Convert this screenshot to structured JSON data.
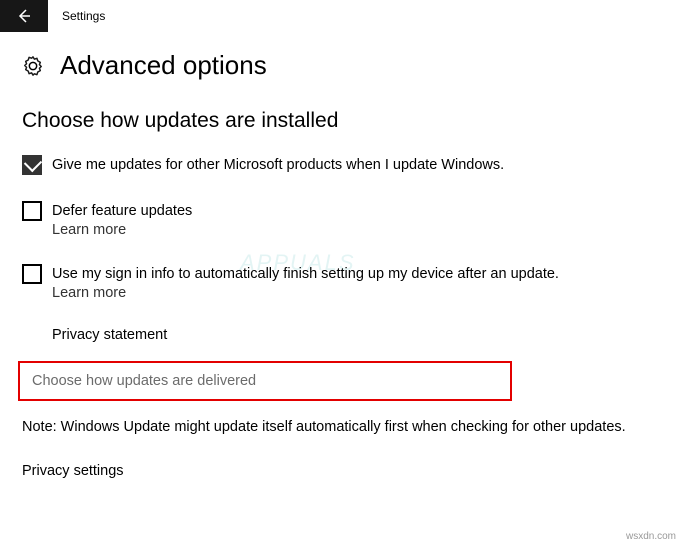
{
  "titlebar": {
    "title": "Settings"
  },
  "header": {
    "page_title": "Advanced options"
  },
  "section": {
    "heading": "Choose how updates are installed"
  },
  "options": {
    "microsoft_products": {
      "label": "Give me updates for other Microsoft products when I update Windows.",
      "checked": true
    },
    "defer_feature": {
      "label": "Defer feature updates",
      "learn_more": "Learn more",
      "checked": false
    },
    "sign_in_setup": {
      "label": "Use my sign in info to automatically finish setting up my device after an update.",
      "learn_more": "Learn more",
      "checked": false
    }
  },
  "links": {
    "privacy_statement": "Privacy statement",
    "delivery": "Choose how updates are delivered",
    "privacy_settings": "Privacy settings"
  },
  "note": "Note: Windows Update might update itself automatically first when checking for other updates.",
  "watermark": "APPUALS",
  "footer": "wsxdn.com"
}
